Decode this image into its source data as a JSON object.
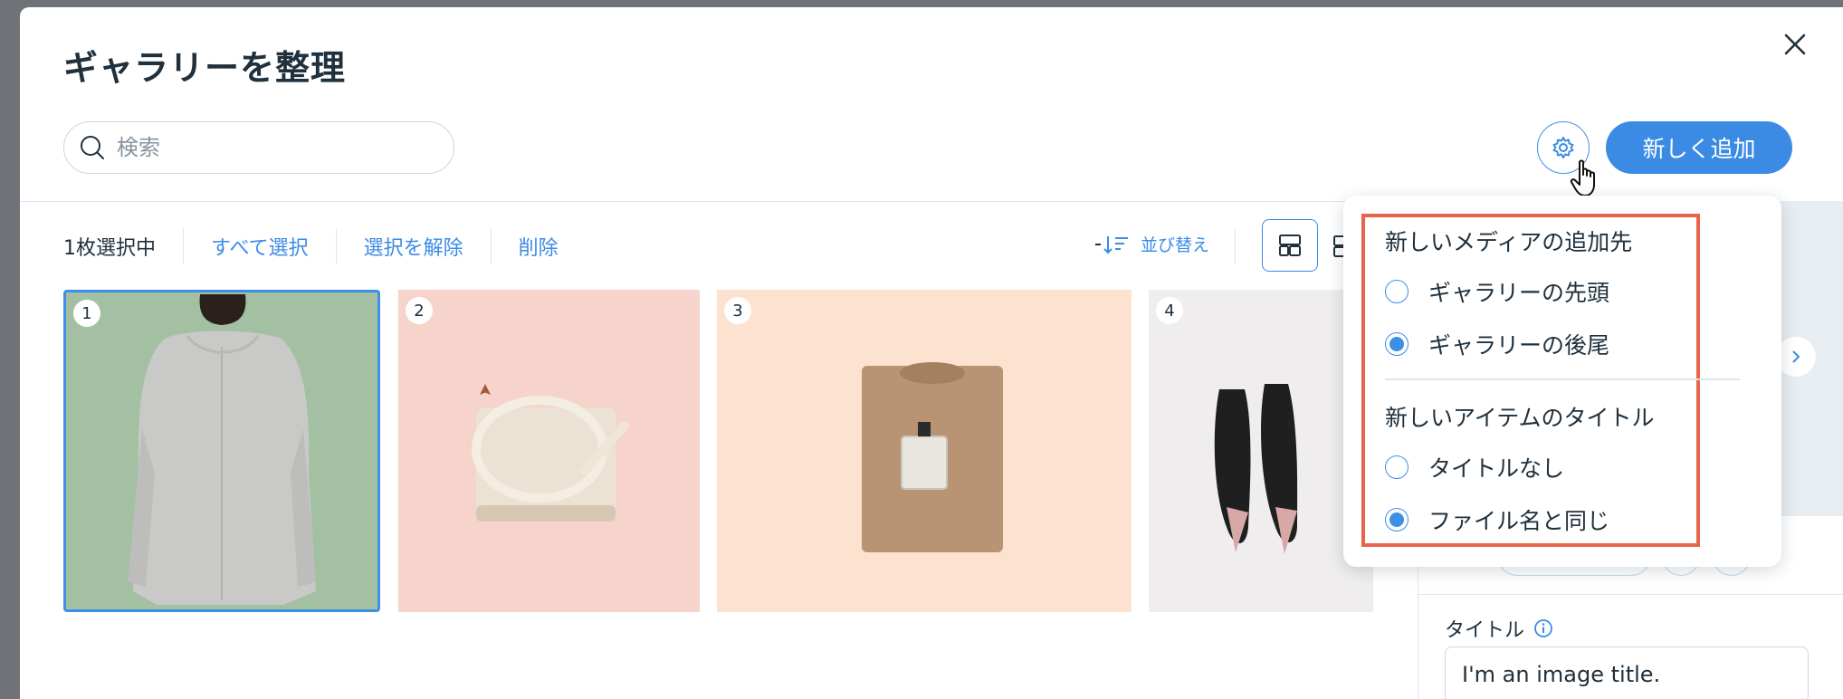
{
  "dialog": {
    "title": "ギャラリーを整理",
    "close_icon": "close-icon"
  },
  "search": {
    "placeholder": "検索",
    "icon": "search-icon"
  },
  "header": {
    "settings_icon": "gear-icon",
    "add_button": "新しく追加"
  },
  "toolbar": {
    "selected_count": "1枚選択中",
    "select_all": "すべて選択",
    "deselect": "選択を解除",
    "delete": "削除",
    "sort_label": "並び替え"
  },
  "gallery": {
    "items": [
      {
        "number": "1",
        "bg": "#a3c0a3",
        "selected": true
      },
      {
        "number": "2",
        "bg": "#f6d4cb",
        "selected": false
      },
      {
        "number": "3",
        "bg": "#fde2cf",
        "selected": false
      },
      {
        "number": "4",
        "bg": "#efedee",
        "selected": false
      }
    ]
  },
  "right_panel": {
    "title_label": "タイトル",
    "title_value": "I'm an image title."
  },
  "settings_popover": {
    "media_heading": "新しいメディアの追加先",
    "media_options": [
      {
        "label": "ギャラリーの先頭",
        "checked": false
      },
      {
        "label": "ギャラリーの後尾",
        "checked": true
      }
    ],
    "title_heading": "新しいアイテムのタイトル",
    "title_options": [
      {
        "label": "タイトルなし",
        "checked": false
      },
      {
        "label": "ファイル名と同じ",
        "checked": true
      }
    ]
  },
  "colors": {
    "accent": "#3b8be5",
    "highlight": "#e8654b",
    "text": "#20303c"
  }
}
